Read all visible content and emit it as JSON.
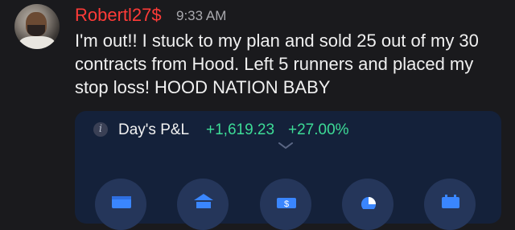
{
  "message": {
    "username": "Robertl27$",
    "timestamp": "9:33 AM",
    "text": "I'm out!! I stuck to my plan and sold 25 out of my 30 contracts from Hood. Left 5 runners and placed my stop loss! HOOD NATION BABY"
  },
  "card": {
    "label": "Day's P&L",
    "amount": "+1,619.23",
    "percent": "+27.00%"
  },
  "colors": {
    "username": "#ff3b38",
    "gain": "#3ddc97",
    "card_bg": "#14213a"
  },
  "icons": [
    "info-icon",
    "chevron-down-icon",
    "wallet-icon",
    "bank-icon",
    "cash-icon",
    "pie-chart-icon",
    "calendar-icon"
  ]
}
